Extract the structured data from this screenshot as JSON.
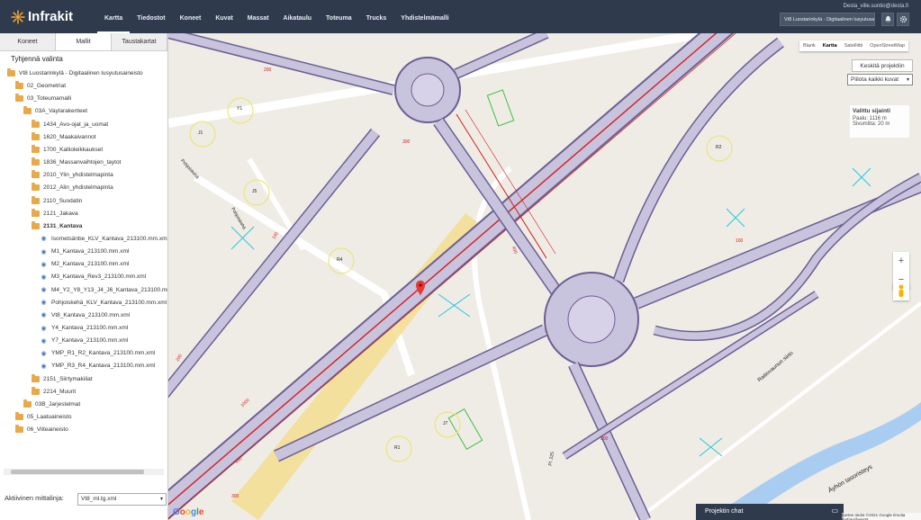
{
  "app": {
    "logo_text": "Infrakit",
    "user_email": "Desta_ville.suntio@desta.fi",
    "project_name": "Vt8 Luostarinkylä - Digitaalinen lusyutusaineisto"
  },
  "nav": {
    "items": [
      "Kartta",
      "Tiedostot",
      "Koneet",
      "Kuvat",
      "Massat",
      "Aikataulu",
      "Toteuma",
      "Trucks",
      "Yhdistelmämalli"
    ],
    "active": "Kartta"
  },
  "sidebar": {
    "tabs": [
      "Koneet",
      "Mallit",
      "Taustakartat"
    ],
    "active_tab": "Mallit",
    "clear_selection": "Tyhjennä valinta",
    "tree": [
      {
        "label": "Vt8 Luostarinkylä - Digitaalinen lusyutusaineisto",
        "type": "folder",
        "indent": 0
      },
      {
        "label": "02_Geometriat",
        "type": "folder",
        "indent": 1
      },
      {
        "label": "03_Toteumamalli",
        "type": "folder",
        "indent": 1
      },
      {
        "label": "03A_Vaylarakenteet",
        "type": "folder",
        "indent": 2
      },
      {
        "label": "1434_Avo-ojat_ja_uomat",
        "type": "folder",
        "indent": 3
      },
      {
        "label": "1620_Maakaivannot",
        "type": "folder",
        "indent": 3
      },
      {
        "label": "1700_Kallioleikkaukset",
        "type": "folder",
        "indent": 3
      },
      {
        "label": "1836_Massanvaihtojen_taytot",
        "type": "folder",
        "indent": 3
      },
      {
        "label": "2010_Ylin_yhdistelmapinta",
        "type": "folder",
        "indent": 3
      },
      {
        "label": "2012_Alin_yhdistelmapinta",
        "type": "folder",
        "indent": 3
      },
      {
        "label": "2110_Suodatin",
        "type": "folder",
        "indent": 3
      },
      {
        "label": "2121_Jakava",
        "type": "folder",
        "indent": 3
      },
      {
        "label": "2131_Kantava",
        "type": "folder",
        "indent": 3,
        "bold": true
      },
      {
        "label": "Isometsänbe_KLV_Kantava_213100.mm.xml",
        "type": "file",
        "indent": 4
      },
      {
        "label": "M1_Kantava_213100.mm.xml",
        "type": "file",
        "indent": 4
      },
      {
        "label": "M2_Kantava_213100.mm.xml",
        "type": "file",
        "indent": 4
      },
      {
        "label": "M3_Kantava_Rev3_213100.mm.xml",
        "type": "file",
        "indent": 4
      },
      {
        "label": "M4_Y2_Y8_Y13_J4_J6_Kantava_213100.mm.xml",
        "type": "file",
        "indent": 4
      },
      {
        "label": "Pohjoiskehä_KLV_Kantava_213100.mm.xml",
        "type": "file",
        "indent": 4
      },
      {
        "label": "Vt8_Kantava_213100.mm.xml",
        "type": "file",
        "indent": 4
      },
      {
        "label": "Y4_Kantava_213100.mm.xml",
        "type": "file",
        "indent": 4
      },
      {
        "label": "Y7_Kantava_213100.mm.xml",
        "type": "file",
        "indent": 4
      },
      {
        "label": "YMP_R1_R2_Kantava_213100.mm.xml",
        "type": "file",
        "indent": 4
      },
      {
        "label": "YMP_R3_R4_Kantava_213100.mm.xml",
        "type": "file",
        "indent": 4
      },
      {
        "label": "2151_Siirtymakiilat",
        "type": "folder",
        "indent": 3
      },
      {
        "label": "2214_Muurit",
        "type": "folder",
        "indent": 3
      },
      {
        "label": "03B_Jarjestelmat",
        "type": "folder",
        "indent": 2
      },
      {
        "label": "05_Laatuaineisto",
        "type": "folder",
        "indent": 1
      },
      {
        "label": "06_Viiteaineisto",
        "type": "folder",
        "indent": 1
      }
    ],
    "active_model_label": "Aktiivinen mittalinja:",
    "active_model_value": "Vt8_ml.tg.xml"
  },
  "map": {
    "map_types": [
      "Blank",
      "Kartta",
      "Satelliitti",
      "OpenStreetMap"
    ],
    "active_map_type": "Kartta",
    "center_button": "Keskitä projektiin",
    "hide_images": "Piilota kaikki kuvat",
    "info": {
      "title": "Valittu sijainti",
      "paalu": "Paalu: 1116 m",
      "sivumitta": "Sivumitta: 20 m"
    },
    "labels": {
      "j1": "J1",
      "y1": "Y1",
      "j5": "J5",
      "r2": "R2",
      "r4": "R4",
      "r1": "R1",
      "j7": "J7",
      "pohjoiskeha_1": "Pohjoiskehä",
      "pohjoiskeha_2": "Pohjoiskehä",
      "aykon_tasoristeys": "Äyhön tasoristeys",
      "paalu_num": "Pl. 225",
      "n_300": "300",
      "n_200a": "200",
      "n_400": "400",
      "n_100": "100",
      "n_500": "500",
      "n_1000": "1000",
      "n_200b": "200",
      "n_200c": "200",
      "n_300b": "300",
      "n_100b": "100",
      "taipale": "Raitiovaunun siirto"
    },
    "chat_label": "Projektin chat",
    "footer": "Kartan tiedot ©2021 Google   Ilmoita karttavirheestä",
    "google": "Google"
  },
  "colors": {
    "topbar": "#2f3b4d",
    "road_fill": "#c9c4dd",
    "road_edge": "#6c5e92",
    "centerline": "#d41c1c",
    "accent_green": "#3fbf3f",
    "water": "#a9cdf0"
  }
}
